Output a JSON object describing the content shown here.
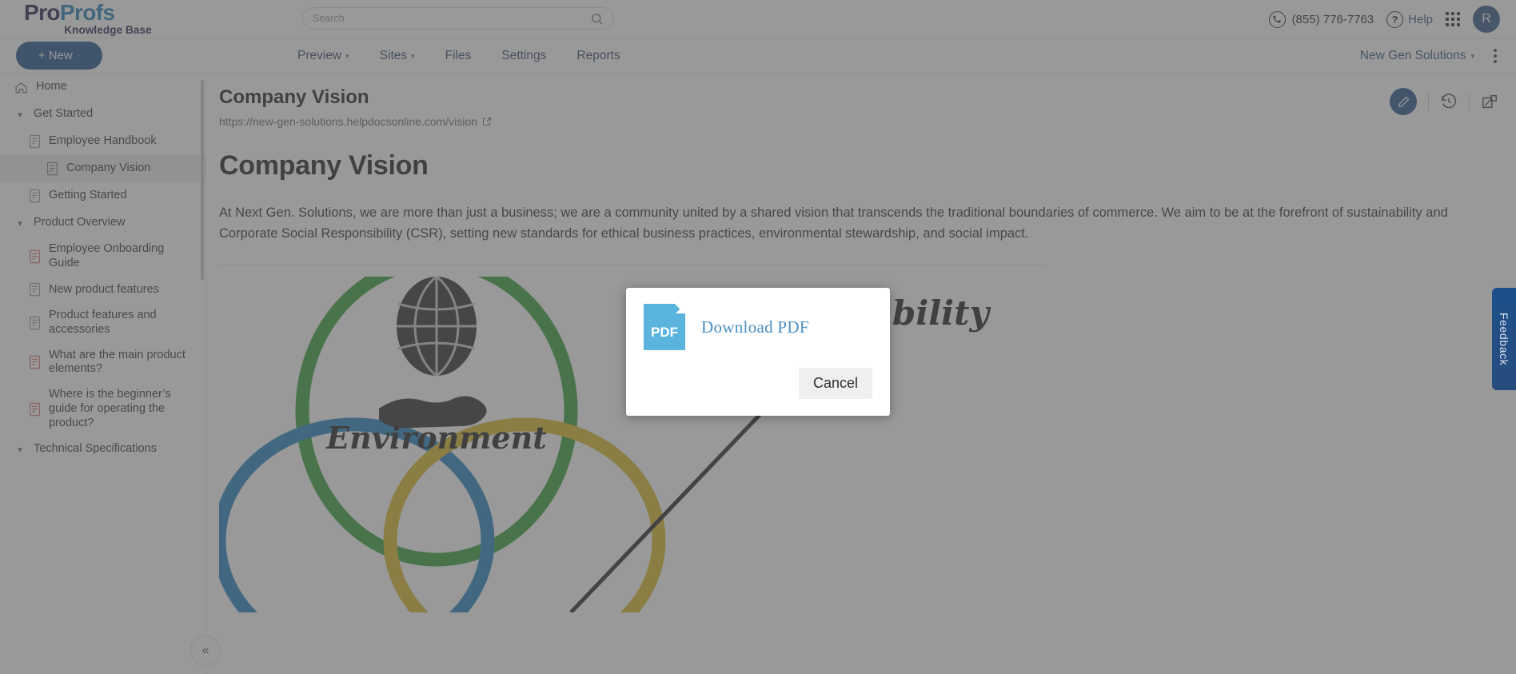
{
  "brand": {
    "name_part1": "Pro",
    "name_part2": "Profs",
    "subtitle": "Knowledge Base"
  },
  "search": {
    "placeholder": "Search",
    "value": ""
  },
  "header": {
    "phone": "(855) 776-7763",
    "help_label": "Help",
    "avatar_initial": "R"
  },
  "nav": {
    "new_button": "+ New",
    "items": [
      {
        "label": "Preview",
        "has_caret": true
      },
      {
        "label": "Sites",
        "has_caret": true
      },
      {
        "label": "Files",
        "has_caret": false
      },
      {
        "label": "Settings",
        "has_caret": false
      },
      {
        "label": "Reports",
        "has_caret": false
      }
    ],
    "site_selector": "New Gen Solutions"
  },
  "sidebar": {
    "items": [
      {
        "label": "Home",
        "level": 1,
        "icon": "home-icon",
        "selected": false
      },
      {
        "label": "Get Started",
        "level": 1,
        "icon": "caret-down-icon",
        "selected": false
      },
      {
        "label": "Employee Handbook",
        "level": 2,
        "icon": "doc-icon-gray",
        "selected": false
      },
      {
        "label": "Company Vision",
        "level": 3,
        "icon": "doc-icon-gray",
        "selected": true
      },
      {
        "label": "Getting Started",
        "level": 2,
        "icon": "doc-icon-gray",
        "selected": false
      },
      {
        "label": "Product Overview",
        "level": 1,
        "icon": "caret-down-icon",
        "selected": false
      },
      {
        "label": "Employee Onboarding Guide",
        "level": 2,
        "icon": "doc-icon-red",
        "selected": false
      },
      {
        "label": "New product features",
        "level": 2,
        "icon": "doc-icon-gray",
        "selected": false
      },
      {
        "label": "Product features and accessories",
        "level": 2,
        "icon": "doc-icon-gray",
        "selected": false
      },
      {
        "label": "What are the main product elements?",
        "level": 2,
        "icon": "doc-icon-red",
        "selected": false
      },
      {
        "label": "Where is the beginner’s guide for operating the product?",
        "level": 2,
        "icon": "doc-icon-red",
        "selected": false
      },
      {
        "label": "Technical Specifications",
        "level": 1,
        "icon": "caret-down-icon",
        "selected": false
      }
    ],
    "collapse_label": "«"
  },
  "document": {
    "title": "Company Vision",
    "url": "https://new-gen-solutions.helpdocsonline.com/vision",
    "heading": "Company Vision",
    "paragraph": "At Next Gen. Solutions, we are more than just a business; we are a community united by a shared vision that transcends the traditional boundaries of commerce. We aim to be at the forefront of sustainability and Corporate Social Responsibility (CSR), setting new standards for ethical business practices, environmental stewardship, and social impact."
  },
  "figure": {
    "label_environment": "Environment",
    "label_sustainability": "Sustainability",
    "colors": {
      "green": "#2f9e33",
      "blue": "#1b7fc0",
      "yellow": "#d9b820"
    }
  },
  "modal": {
    "pdf_icon_text": "PDF",
    "download_label": "Download  PDF",
    "cancel_label": "Cancel"
  },
  "feedback": {
    "label": "Feedback"
  },
  "colors": {
    "brand_navy": "#151a47",
    "brand_blue": "#1878ad",
    "accent_button": "#164a86",
    "pdf_blue": "#5bb4de",
    "link_blue": "#4a90c4"
  }
}
